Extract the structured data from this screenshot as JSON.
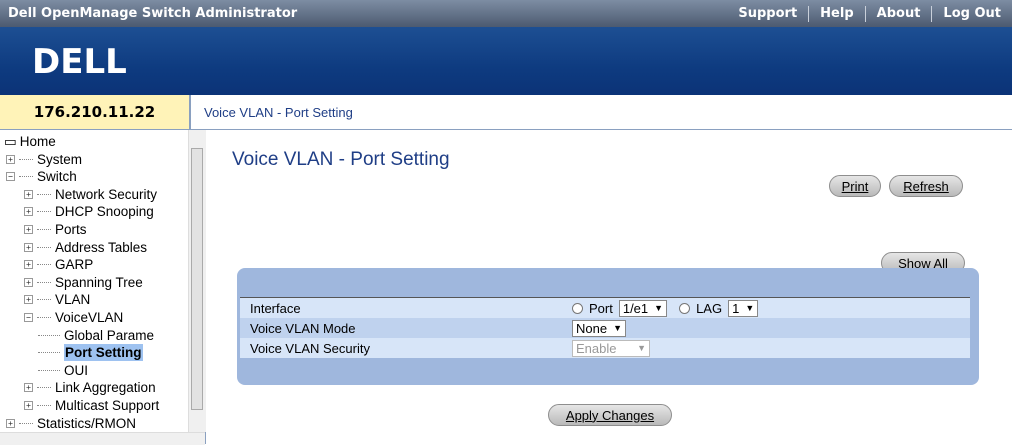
{
  "header": {
    "app_title": "Dell OpenManage Switch Administrator",
    "links": [
      "Support",
      "Help",
      "About",
      "Log Out"
    ]
  },
  "logo_text": "DELL",
  "ip_address": "176.210.11.22",
  "breadcrumb": "Voice VLAN - Port Setting",
  "tree": {
    "items": [
      {
        "label": "Home",
        "expander": "",
        "level": 0
      },
      {
        "label": "System",
        "expander": "+",
        "level": 1
      },
      {
        "label": "Switch",
        "expander": "−",
        "level": 1
      },
      {
        "label": "Network Security",
        "expander": "+",
        "level": 2
      },
      {
        "label": "DHCP Snooping",
        "expander": "+",
        "level": 2
      },
      {
        "label": "Ports",
        "expander": "+",
        "level": 2
      },
      {
        "label": "Address Tables",
        "expander": "+",
        "level": 2
      },
      {
        "label": "GARP",
        "expander": "+",
        "level": 2
      },
      {
        "label": "Spanning Tree",
        "expander": "+",
        "level": 2
      },
      {
        "label": "VLAN",
        "expander": "+",
        "level": 2
      },
      {
        "label": "VoiceVLAN",
        "expander": "−",
        "level": 2
      },
      {
        "label": "Global Parame",
        "expander": "",
        "level": 3
      },
      {
        "label": "Port Setting",
        "expander": "",
        "level": 3,
        "selected": true
      },
      {
        "label": "OUI",
        "expander": "",
        "level": 3
      },
      {
        "label": "Link Aggregation",
        "expander": "+",
        "level": 2
      },
      {
        "label": "Multicast Support",
        "expander": "+",
        "level": 2
      },
      {
        "label": "Statistics/RMON",
        "expander": "+",
        "level": 1
      }
    ]
  },
  "main": {
    "title": "Voice VLAN - Port Setting",
    "print_label": "Print",
    "refresh_label": "Refresh",
    "show_all_label": "Show All",
    "apply_label": "Apply Changes",
    "fields": {
      "interface_label": "Interface",
      "port_radio_label": "Port",
      "port_value": "1/e1",
      "lag_radio_label": "LAG",
      "lag_value": "1",
      "mode_label": "Voice VLAN Mode",
      "mode_value": "None",
      "security_label": "Voice VLAN Security",
      "security_value": "Enable"
    }
  },
  "colors": {
    "topbar": "#5c6b82",
    "logo_band": "#0e3b80",
    "ip_box": "#fff3b8",
    "accent_text": "#1f3e86",
    "panel": "#9fb7dd",
    "selection": "#9ec2f0"
  }
}
